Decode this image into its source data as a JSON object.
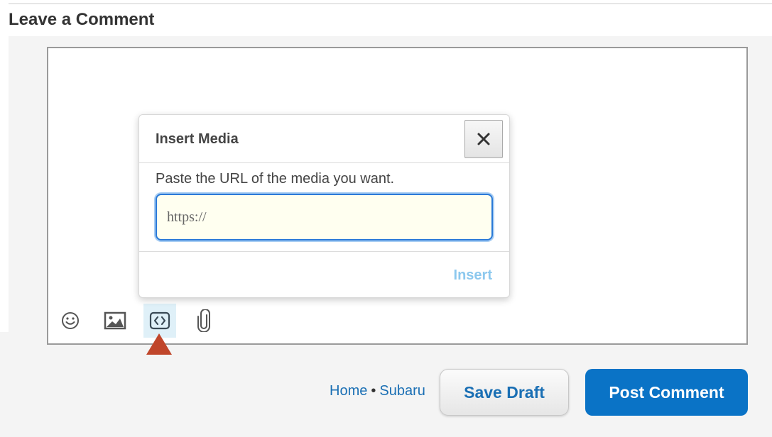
{
  "comment_section": {
    "heading": "Leave a Comment"
  },
  "insert_media_dialog": {
    "title": "Insert Media",
    "close_icon": "close-icon",
    "prompt": "Paste the URL of the media you want.",
    "url_input": {
      "value": "",
      "placeholder": "https://"
    },
    "insert_label": "Insert"
  },
  "toolbar": {
    "icons": [
      "smiley-icon",
      "image-icon",
      "embed-code-icon",
      "paperclip-icon"
    ],
    "active": "embed-code-icon"
  },
  "footer": {
    "links": [
      "Home",
      "Subaru"
    ],
    "separator": "•",
    "save_draft_label": "Save Draft",
    "post_comment_label": "Post Comment"
  },
  "colors": {
    "accent_blue": "#0a73c6",
    "link_blue": "#1a6fb4",
    "insert_disabled": "#8cc8ee",
    "input_focus": "#2b7ad8",
    "pointer_red": "#c0462b"
  }
}
